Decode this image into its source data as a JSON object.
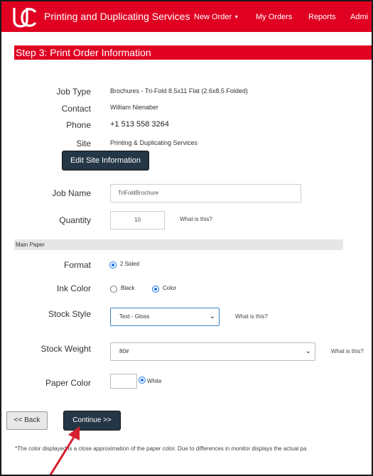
{
  "nav": {
    "brand": "Printing and Duplicating Services",
    "items": [
      "New Order",
      "My Orders",
      "Reports",
      "Admi"
    ],
    "accent": "#e00122"
  },
  "step": {
    "title": "Step 3: Print Order Information"
  },
  "info": {
    "job_type_label": "Job Type",
    "job_type_value": "Brochures - Tri-Fold 8.5x11 Flat (2.6x8.5 Folded)",
    "contact_label": "Contact",
    "contact_value": "William Nienaber",
    "phone_label": "Phone",
    "phone_value": "+1 513 558 3264",
    "site_label": "Site",
    "site_value": "Printing & Duplicating Services",
    "edit_site_button": "Edit Site Information"
  },
  "job": {
    "name_label": "Job Name",
    "name_value": "TriFoldBrochure",
    "quantity_label": "Quantity",
    "quantity_value": "10",
    "quantity_help": "What is this?"
  },
  "main_paper": {
    "section_title": "Main Paper",
    "format_label": "Format",
    "format_option": "2 Sided",
    "ink_label": "Ink Color",
    "ink_options": [
      "Black",
      "Color"
    ],
    "ink_selected": "Color",
    "stock_style_label": "Stock Style",
    "stock_style_value": "Text - Gloss",
    "stock_style_help": "What is this?",
    "stock_weight_label": "Stock Weight",
    "stock_weight_value": "80#",
    "stock_weight_help": "What is this?",
    "paper_color_label": "Paper Color",
    "paper_color_option": "White"
  },
  "actions": {
    "back": "<< Back",
    "continue": "Continue >>"
  },
  "footnote": "*The color displayed is a close approximation of the paper color. Due to differences in monitor displays the actual pa",
  "icons": {
    "logo": "uc-logo-icon",
    "caret": "caret-down-icon",
    "chevron": "chevron-down-icon",
    "arrow": "red-arrow-annotation"
  }
}
